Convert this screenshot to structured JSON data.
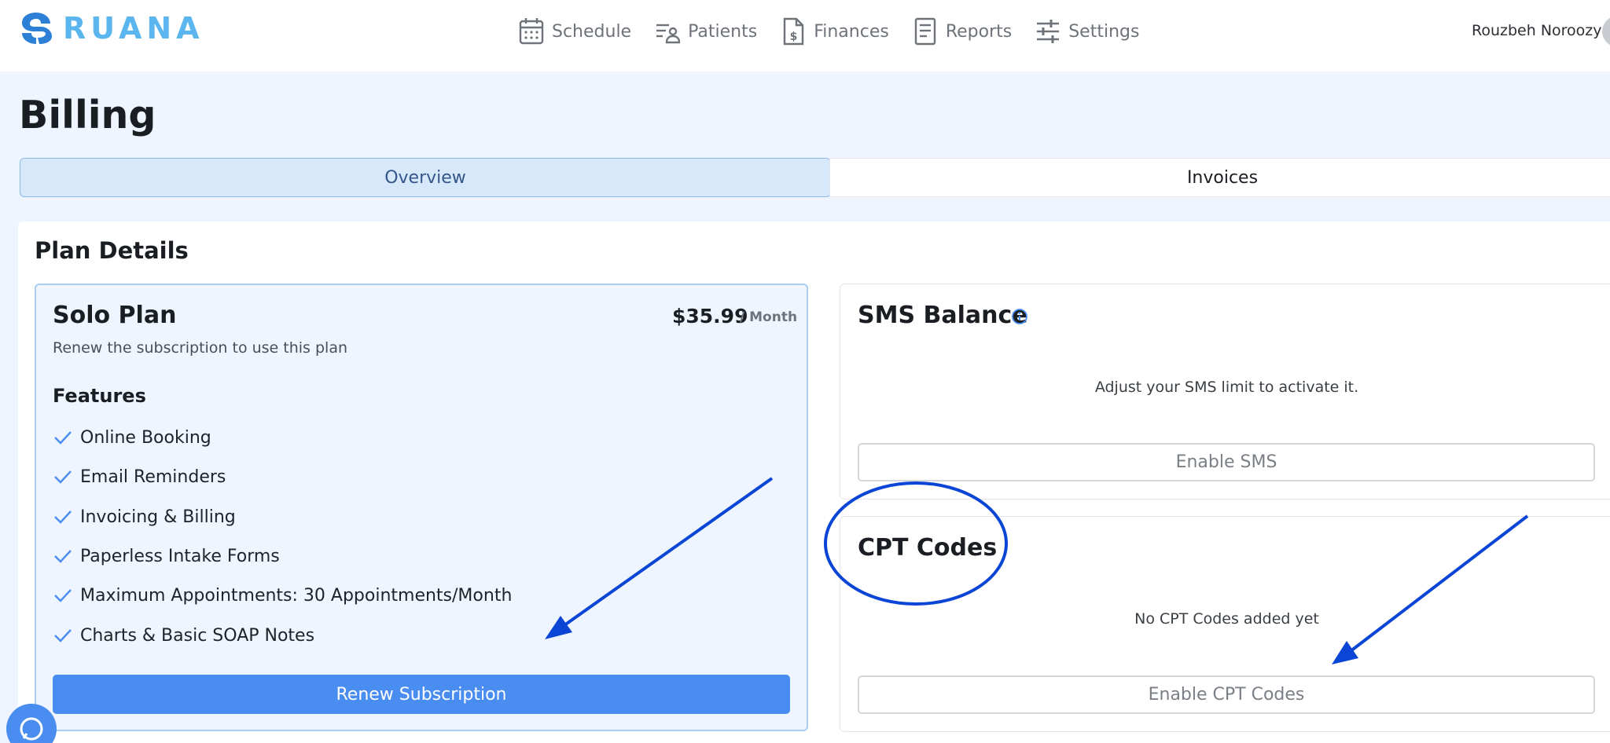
{
  "header": {
    "logo_text": "RUANA",
    "nav": [
      {
        "label": "Schedule",
        "icon": "calendar-icon"
      },
      {
        "label": "Patients",
        "icon": "patients-icon"
      },
      {
        "label": "Finances",
        "icon": "finance-doc-icon"
      },
      {
        "label": "Reports",
        "icon": "report-icon"
      },
      {
        "label": "Settings",
        "icon": "sliders-icon"
      }
    ],
    "user_name": "Rouzbeh Noroozy"
  },
  "page": {
    "title": "Billing",
    "tabs": [
      {
        "label": "Overview",
        "active": true
      },
      {
        "label": "Invoices",
        "active": false
      }
    ]
  },
  "plan_details": {
    "title": "Plan Details",
    "plan": {
      "name": "Solo Plan",
      "price": "$35.99",
      "price_unit": "/ Month",
      "description": "Renew the subscription to use this plan",
      "features_title": "Features",
      "features": [
        "Online Booking",
        "Email Reminders",
        "Invoicing & Billing",
        "Paperless Intake Forms",
        "Maximum Appointments: 30 Appointments/Month",
        "Charts & Basic SOAP Notes"
      ],
      "renew_label": "Renew Subscription"
    },
    "sms": {
      "title": "SMS Balance",
      "message": "Adjust your SMS limit to activate it.",
      "button_label": "Enable SMS"
    },
    "cpt": {
      "title": "CPT Codes",
      "message": "No CPT Codes added yet",
      "button_label": "Enable CPT Codes"
    }
  },
  "colors": {
    "primary": "#4a8df0",
    "logo_blue": "#2e7fd6",
    "logo_text": "#5bb6ef",
    "annotation": "#0a45d6",
    "page_bg": "#eef5fe"
  }
}
